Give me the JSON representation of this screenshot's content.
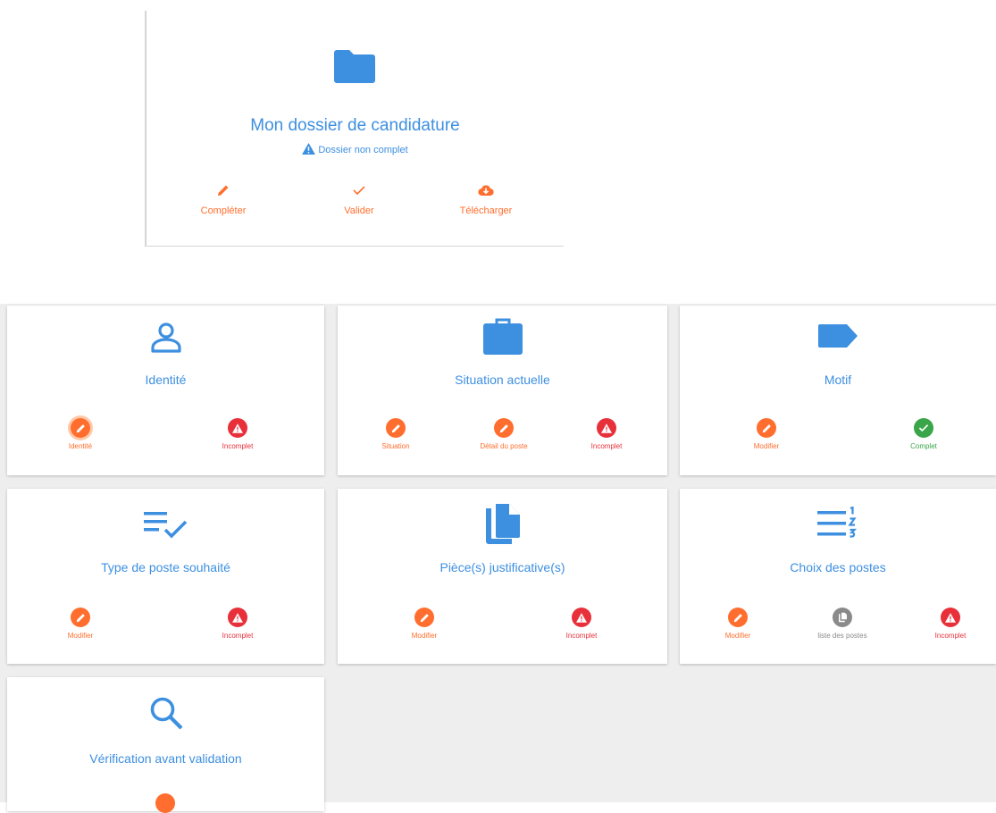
{
  "colors": {
    "accent": "#3d8fe0",
    "orange": "#ff6e2e",
    "red": "#e8303b",
    "green": "#3aa549",
    "grey": "#8a8a8a"
  },
  "dossier": {
    "title": "Mon dossier de candidature",
    "status": "Dossier non complet",
    "icon": "folder-icon",
    "actions": [
      {
        "label": "Compléter",
        "icon": "pencil-icon"
      },
      {
        "label": "Valider",
        "icon": "check-icon"
      },
      {
        "label": "Télécharger",
        "icon": "cloud-download-icon"
      }
    ]
  },
  "cards": [
    {
      "title": "Identité",
      "icon": "person-icon",
      "actions": [
        {
          "label": "Identité",
          "icon": "pencil-icon",
          "state": "active"
        },
        {
          "label": "Incomplet",
          "icon": "warning-icon",
          "state": "incomplete"
        }
      ]
    },
    {
      "title": "Situation actuelle",
      "icon": "briefcase-icon",
      "actions": [
        {
          "label": "Situation",
          "icon": "pencil-icon"
        },
        {
          "label": "Détail du poste",
          "icon": "pencil-icon"
        },
        {
          "label": "Incomplet",
          "icon": "warning-icon",
          "state": "incomplete"
        }
      ]
    },
    {
      "title": "Motif",
      "icon": "label-icon",
      "actions": [
        {
          "label": "Modifier",
          "icon": "pencil-icon"
        },
        {
          "label": "Complet",
          "icon": "check-circle-icon",
          "state": "complete"
        }
      ]
    },
    {
      "title": "Type de poste souhaité",
      "icon": "playlist-check-icon",
      "actions": [
        {
          "label": "Modifier",
          "icon": "pencil-icon"
        },
        {
          "label": "Incomplet",
          "icon": "warning-icon",
          "state": "incomplete"
        }
      ]
    },
    {
      "title": "Pièce(s) justificative(s)",
      "icon": "copy-file-icon",
      "actions": [
        {
          "label": "Modifier",
          "icon": "pencil-icon"
        },
        {
          "label": "Incomplet",
          "icon": "warning-icon",
          "state": "incomplete"
        }
      ]
    },
    {
      "title": "Choix des postes",
      "icon": "ordered-list-icon",
      "actions": [
        {
          "label": "Modifier",
          "icon": "pencil-icon"
        },
        {
          "label": "liste des postes",
          "icon": "copy-icon",
          "state": "neutral"
        },
        {
          "label": "Incomplet",
          "icon": "warning-icon",
          "state": "incomplete"
        }
      ]
    },
    {
      "title": "Vérification avant validation",
      "icon": "search-icon",
      "actions": []
    }
  ]
}
